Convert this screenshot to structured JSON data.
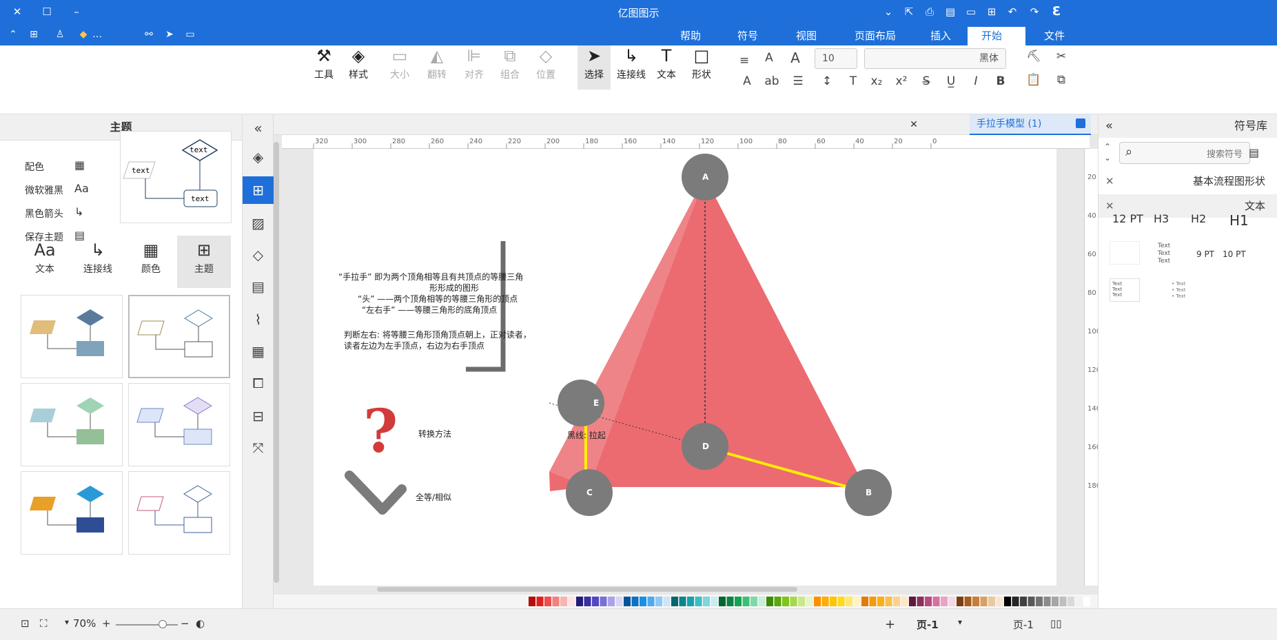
{
  "titlebar": {
    "title": "亿图图示"
  },
  "menu": {
    "tabs": [
      "文件",
      "开始",
      "插入",
      "页面布局",
      "视图",
      "符号",
      "帮助"
    ],
    "active": "开始"
  },
  "ribbon": {
    "font_name": "黑体",
    "font_size": "10",
    "tools": {
      "shape": "形状",
      "text": "文本",
      "connector": "连接线",
      "select": "选择",
      "position": "位置",
      "group": "组合",
      "align": "对齐",
      "rotate": "翻转",
      "size": "大小",
      "style": "样式",
      "tools": "工具"
    }
  },
  "left_panel": {
    "title": "主题",
    "menu_items": [
      "主题",
      "颜色",
      "连接线",
      "文本"
    ],
    "list_items": [
      "配色",
      "微软雅黑",
      "黑色箭头",
      "保存主题"
    ],
    "preview_text": [
      "text",
      "text",
      "text"
    ]
  },
  "document": {
    "tab_title": "手拉手模型 (1)"
  },
  "diagram": {
    "vertices": [
      "A",
      "B",
      "C",
      "D",
      "E"
    ],
    "block1": [
      "“手拉手” 即为两个顶角相等且有共顶点的等腰三角",
      "形形成的图形",
      "“头” ——两个顶角相等的等腰三角形的顶点",
      "“左右手” ——等腰三角形的底角顶点"
    ],
    "block2": [
      "判断左右: 将等腰三角形顶角顶点朝上，正对读者，",
      "读者左边为左手顶点，右边为右手顶点"
    ],
    "label_method": "转换方法",
    "label_similar": "全等/相似",
    "label_edge": "黑线: 拉起"
  },
  "right_panel": {
    "title": "符号库",
    "search_placeholder": "搜索符号",
    "section_flow": "基本流程图形状",
    "section_text": "文本",
    "headings": [
      "H1",
      "H2",
      "H3",
      "12 PT"
    ],
    "sizes": [
      "10 PT",
      "9 PT"
    ]
  },
  "statusbar": {
    "page_label": "页-1",
    "page_tab": "页-1",
    "zoom": "70%"
  },
  "colors": {
    "accent": "#1e6fd9",
    "triangle": "#eb6b70",
    "vertex": "#7b7b7b",
    "yellow": "#ffee00"
  }
}
